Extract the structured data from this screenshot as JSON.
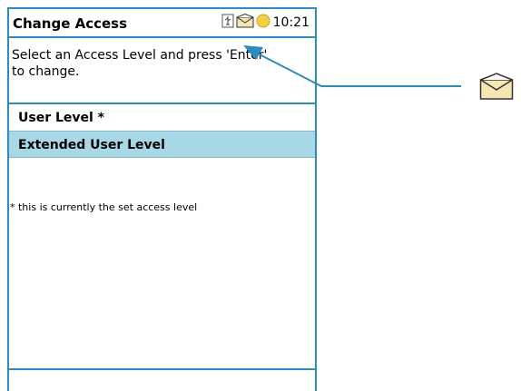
{
  "window": {
    "title": "Change Access",
    "clock": "10:21"
  },
  "status_icons": [
    "usb-icon",
    "message-icon",
    "battery-dot-icon"
  ],
  "instruction": {
    "line1": "Select an Access Level and press 'Enter'",
    "line2": "to change."
  },
  "access_levels": [
    {
      "label": "User Level *",
      "selected": false
    },
    {
      "label": "Extended User Level",
      "selected": true
    }
  ],
  "note": "* this is currently the set access level",
  "callout": {
    "icon": "message-icon",
    "accent_color": "#2a8cc4"
  },
  "colors": {
    "border": "#2a8cc4",
    "selection": "#a8d8e6"
  }
}
